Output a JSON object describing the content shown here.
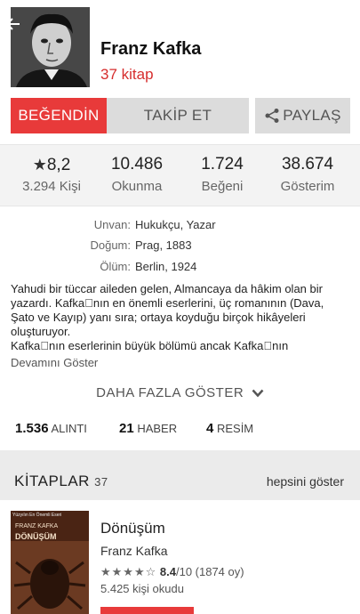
{
  "author": {
    "name": "Franz Kafka",
    "book_count": "37 kitap"
  },
  "actions": {
    "like": "BEĞENDİN",
    "follow": "TAKİP ET",
    "share": "PAYLAŞ"
  },
  "stats": [
    {
      "value": "8,2",
      "label": "3.294 Kişi"
    },
    {
      "value": "10.486",
      "label": "Okunma"
    },
    {
      "value": "1.724",
      "label": "Beğeni"
    },
    {
      "value": "38.674",
      "label": "Gösterim"
    }
  ],
  "details": [
    {
      "key": "Unvan:",
      "value": "Hukukçu, Yazar"
    },
    {
      "key": "Doğum:",
      "value": "Prag, 1883"
    },
    {
      "key": "Ölüm:",
      "value": "Berlin, 1924"
    }
  ],
  "bio": {
    "lines": [
      "Yahudi bir tüccar aileden gelen, Almancaya da hâkim olan bir",
      "yazardı. Kafka\u0000nın en önemli eserlerini, üç romanının (Dava,",
      "Şato ve Kayıp) yanı sıra; ortaya koyduğu birçok hikâyeleri",
      "oluşturuyor.",
      "Kafka\u0000nın eserlerinin büyük bölümü ancak Kafka\u0000nın"
    ],
    "more_link": "Devamını Göster"
  },
  "show_more": "DAHA FAZLA GÖSTER",
  "counts": [
    {
      "value": "1.536",
      "label": "ALINTI"
    },
    {
      "value": "21",
      "label": "HABER"
    },
    {
      "value": "4",
      "label": "RESİM"
    }
  ],
  "books_section": {
    "title": "KİTAPLAR",
    "count": "37",
    "show_all": "hepsini göster"
  },
  "book": {
    "cover_top": "Yüzyılın En Önemli Eseri",
    "cover_author": "FRANZ KAFKA",
    "cover_title": "DÖNÜŞÜM",
    "title": "Dönüşüm",
    "author": "Franz Kafka",
    "stars": "★★★★☆",
    "score": "8.4",
    "score_suffix": "/10 (1874 oy)",
    "readers": "5.425 kişi okudu"
  },
  "colors": {
    "accent": "#e83a3a",
    "book_count": "#d62d2d"
  }
}
